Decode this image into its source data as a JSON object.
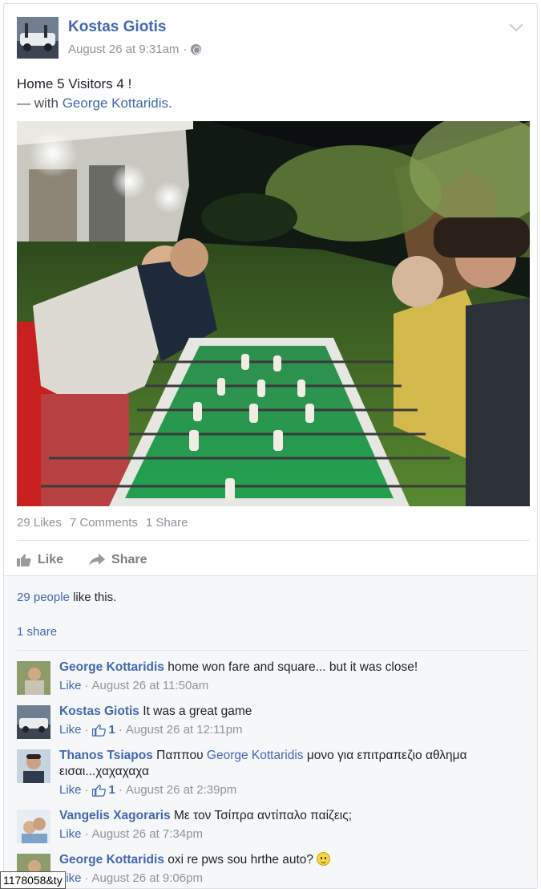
{
  "post": {
    "author": "Kostas Giotis",
    "timestamp": "August 26 at 9:31am",
    "separator": "·",
    "status_line1": "Home 5 Visitors 4 !",
    "status_with_prefix": "— with",
    "status_with_name": "George Kottaridis",
    "status_with_suffix": ".",
    "counts": {
      "likes": "29 Likes",
      "comments": "7 Comments",
      "shares": "1 Share"
    },
    "actions": {
      "like": "Like",
      "share": "Share"
    }
  },
  "ufi": {
    "like_sentence_link": "29 people",
    "like_sentence_rest": " like this.",
    "share_line": "1 share"
  },
  "comments": [
    {
      "name": "George Kottaridis",
      "text": " home won fare and square... but it was close!",
      "like": "Like",
      "time": "August 26 at 11:50am"
    },
    {
      "name": "Kostas Giotis",
      "text": " It was a great game",
      "like": "Like",
      "likes": "1",
      "time": "August 26 at 12:11pm"
    },
    {
      "name": "Thanos Tsiapos",
      "text_before": " Παππου ",
      "mention": "George Kottaridis",
      "text_after": " μονο για επιτραπεζιο αθλημα εισαι...χαχαχαχα",
      "like": "Like",
      "likes": "1",
      "time": "August 26 at 2:39pm"
    },
    {
      "name": "Vangelis Xagoraris",
      "text": " Με τον Τσίπρα αντίπαλο παίζεις;",
      "like": "Like",
      "time": "August 26 at 7:34pm"
    },
    {
      "name": "George Kottaridis",
      "text": " oxi re pws sou hrthe auto? ",
      "like": "Like",
      "time": "August 26 at 9:06pm"
    }
  ],
  "url_fragment": "1178058&ty",
  "icons": {
    "globe": "globe-icon",
    "chevron": "chevron-down-icon",
    "like": "thumbs-up-icon",
    "share": "share-arrow-icon",
    "smiley": "smiley-emoji-icon"
  },
  "colors": {
    "link": "#4267b2",
    "meta": "#90949c",
    "ufi_background": "#f6f7f9"
  }
}
